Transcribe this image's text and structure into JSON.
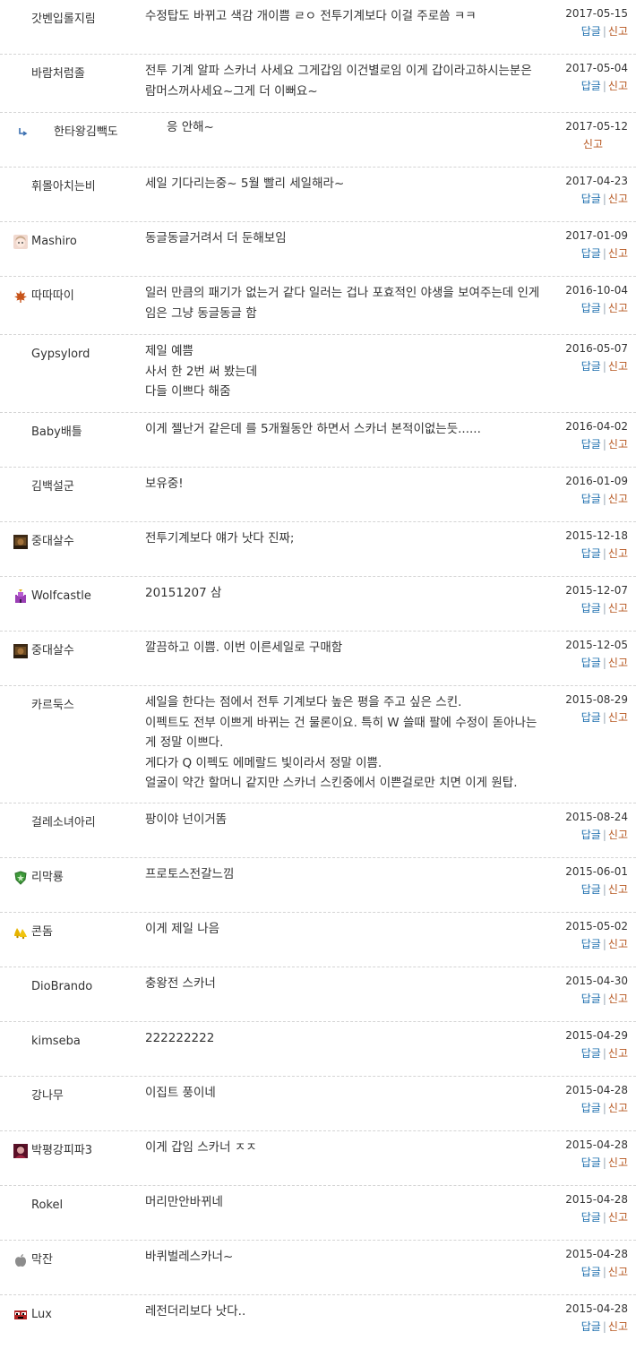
{
  "labels": {
    "reply": "답글",
    "sep": "|",
    "report": "신고"
  },
  "comments": [
    {
      "nick": "갓벤입롤지림",
      "avatar": "",
      "date": "2017-05-15",
      "lines": [
        "수정탑도 바뀌고 색감 개이쁨 ㄹㅇ 전투기계보다 이걸 주로씀 ㅋㅋ"
      ],
      "reply": true
    },
    {
      "nick": "바람처럼졸",
      "avatar": "",
      "date": "2017-05-04",
      "lines": [
        "전투 기계 알파 스카너 사세요 그게갑임 이건별로임 이게 갑이라고하시는분은",
        "람머스꺼사세요~그게 더 이뻐요~"
      ],
      "reply": true
    },
    {
      "nick": "한타왕김빽도",
      "avatar": "arrow-icon",
      "date": "2017-05-12",
      "lines": [
        "응 안해~"
      ],
      "reply": false,
      "nested": true
    },
    {
      "nick": "휘몰아치는비",
      "avatar": "",
      "date": "2017-04-23",
      "lines": [
        "세일 기다리는중~ 5월 빨리 세일해라~"
      ],
      "reply": true
    },
    {
      "nick": "Mashiro",
      "avatar": "anime-avatar-icon",
      "date": "2017-01-09",
      "lines": [
        "동글동글거려서 더 둔해보임"
      ],
      "reply": true
    },
    {
      "nick": "따따따이",
      "avatar": "maple-leaf-icon",
      "date": "2016-10-04",
      "lines": [
        "일러 만큼의 패기가 없는거 같다 일러는 겁나 포효적인 야생을 보여주는데 인게",
        "임은 그냥 동글동글 함"
      ],
      "reply": true
    },
    {
      "nick": "Gypsylord",
      "avatar": "",
      "date": "2016-05-07",
      "lines": [
        "제일 예쁨",
        "사서 한 2번 써 봤는데",
        "다들 이쁘다 해줌"
      ],
      "reply": true
    },
    {
      "nick": "Baby배틀",
      "avatar": "",
      "date": "2016-04-02",
      "lines": [
        "이게 젤난거 같은데 를 5개월동안 하면서 스카너 본적이없는듯......"
      ],
      "reply": true
    },
    {
      "nick": "김백설군",
      "avatar": "",
      "date": "2016-01-09",
      "lines": [
        "보유중!"
      ],
      "reply": true
    },
    {
      "nick": "중대살수",
      "avatar": "game-avatar-icon",
      "date": "2015-12-18",
      "lines": [
        "전투기계보다 얘가 낫다 진짜;"
      ],
      "reply": true
    },
    {
      "nick": "Wolfcastle",
      "avatar": "castle-icon",
      "date": "2015-12-07",
      "lines": [
        "20151207 삼"
      ],
      "reply": true
    },
    {
      "nick": "중대살수",
      "avatar": "game-avatar-icon",
      "date": "2015-12-05",
      "lines": [
        "깔끔하고 이쁨. 이번 이른세일로 구매함"
      ],
      "reply": true
    },
    {
      "nick": "카르둑스",
      "avatar": "",
      "date": "2015-08-29",
      "lines": [
        "세일을 한다는 점에서 전투 기계보다 높은 평을 주고 싶은 스킨.",
        "이펙트도 전부 이쁘게 바뀌는 건 물론이요. 특히 W 쓸때 팔에 수정이 돋아나는",
        "게 정말 이쁘다.",
        "게다가 Q 이펙도 에메랄드 빛이라서 정말 이쁨.",
        "얼굴이 약간 할머니 같지만 스카너 스킨중에서 이쁜걸로만 치면 이게 원탑."
      ],
      "reply": true
    },
    {
      "nick": "걸레소녀아리",
      "avatar": "",
      "date": "2015-08-24",
      "lines": [
        "팡이야 넌이거똠"
      ],
      "reply": true
    },
    {
      "nick": "리막룡",
      "avatar": "shield-badge-icon",
      "date": "2015-06-01",
      "lines": [
        "프로토스전갈느낌"
      ],
      "reply": true
    },
    {
      "nick": "콘돔",
      "avatar": "bells-icon",
      "date": "2015-05-02",
      "lines": [
        "이게 제일 나음"
      ],
      "reply": true
    },
    {
      "nick": "DioBrando",
      "avatar": "",
      "date": "2015-04-30",
      "lines": [
        "충왕전 스카너"
      ],
      "reply": true
    },
    {
      "nick": "kimseba",
      "avatar": "",
      "date": "2015-04-29",
      "lines": [
        "222222222"
      ],
      "reply": true
    },
    {
      "nick": "강나무",
      "avatar": "",
      "date": "2015-04-28",
      "lines": [
        "이집트 풍이네"
      ],
      "reply": true
    },
    {
      "nick": "박평강피파3",
      "avatar": "character-avatar-icon",
      "date": "2015-04-28",
      "lines": [
        "이게 갑임 스카너 ㅈㅈ"
      ],
      "reply": true
    },
    {
      "nick": "Rokel",
      "avatar": "",
      "date": "2015-04-28",
      "lines": [
        "머리만안바뀌네"
      ],
      "reply": true
    },
    {
      "nick": "막잔",
      "avatar": "apple-icon",
      "date": "2015-04-28",
      "lines": [
        "바퀴벌레스카너~"
      ],
      "reply": true
    },
    {
      "nick": "Lux",
      "avatar": "mask-icon",
      "date": "2015-04-28",
      "lines": [
        "레전더리보다 낫다.."
      ],
      "reply": true
    }
  ]
}
